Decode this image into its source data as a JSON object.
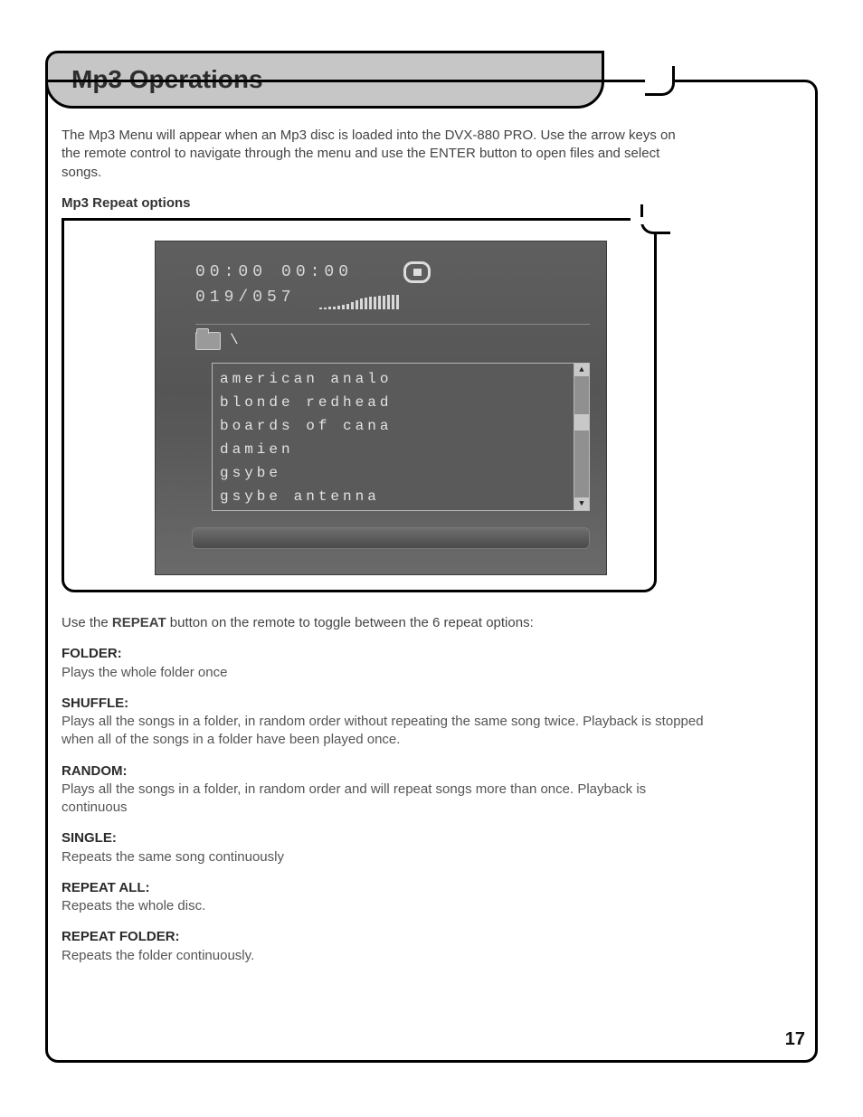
{
  "title": "Mp3 Operations",
  "intro": "The Mp3 Menu will appear when an Mp3 disc is loaded into the DVX-880 PRO.  Use the arrow keys on the remote control to navigate through the menu and use the ENTER button to open files and select songs.",
  "repeat_heading": "Mp3 Repeat options",
  "screenshot": {
    "time_elapsed": "00:00",
    "time_total": "00:00",
    "track_counter": "019/057",
    "path": "\\",
    "items": [
      "american analo",
      "blonde redhead",
      "boards of cana",
      "damien",
      "gsybe",
      "gsybe antenna"
    ],
    "scroll_up": "▲",
    "scroll_down": "▼"
  },
  "toggle_text_pre": "Use the ",
  "toggle_text_btn": "REPEAT",
  "toggle_text_post": " button on the remote to toggle between the 6 repeat options:",
  "options": [
    {
      "label": "FOLDER:",
      "desc": "Plays the whole folder once"
    },
    {
      "label": "SHUFFLE:",
      "desc": "Plays all the songs in a folder, in random order without repeating the same song twice. Playback is stopped when all of the songs in a folder have been played once."
    },
    {
      "label": "RANDOM:",
      "desc": "Plays all the songs in a folder, in random order and will repeat songs more than once. Playback is continuous"
    },
    {
      "label": "SINGLE:",
      "desc": "Repeats the same song continuously"
    },
    {
      "label": "REPEAT ALL:",
      "desc": "Repeats the whole disc."
    },
    {
      "label": "REPEAT FOLDER:",
      "desc": "Repeats the folder continuously."
    }
  ],
  "page_number": "17"
}
